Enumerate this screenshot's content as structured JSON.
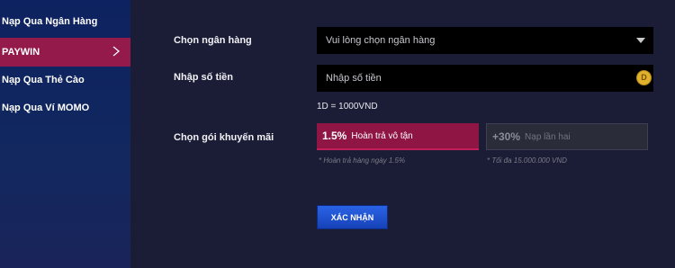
{
  "sidebar": {
    "items": [
      {
        "label": "Nạp Qua Ngân Hàng"
      },
      {
        "label": "PAYWIN"
      },
      {
        "label": "Nạp Qua Thẻ Cào"
      },
      {
        "label": "Nạp Qua Ví MOMO"
      }
    ],
    "active_index": 1
  },
  "form": {
    "bank": {
      "label": "Chọn ngân hàng",
      "value": "Vui lòng chọn ngân hàng"
    },
    "amount": {
      "label": "Nhập số tiền",
      "placeholder": "Nhập số tiền",
      "coin_symbol": "D",
      "rate": "1D = 1000VND"
    },
    "promo": {
      "label": "Chọn gói khuyến mãi",
      "packages": [
        {
          "percent": "1.5%",
          "text": "Hoàn trả vô tận",
          "note": "* Hoàn trả hàng ngày 1.5%",
          "selected": true
        },
        {
          "percent": "+30%",
          "text": "Nạp lần hai",
          "note": "* Tối đa 15.000.000 VND",
          "selected": false
        }
      ]
    },
    "submit_label": "XÁC NHẬN"
  },
  "colors": {
    "sidebar_bg": "#0d2260",
    "active_item": "#931a4b",
    "main_bg": "#1b1d36",
    "input_bg": "#000000",
    "promo_active": "#8e1544",
    "button": "#1f4fd0"
  },
  "icons": {
    "chevron": "chevron-right-icon",
    "caret": "caret-down-icon",
    "coin": "coin-icon"
  }
}
